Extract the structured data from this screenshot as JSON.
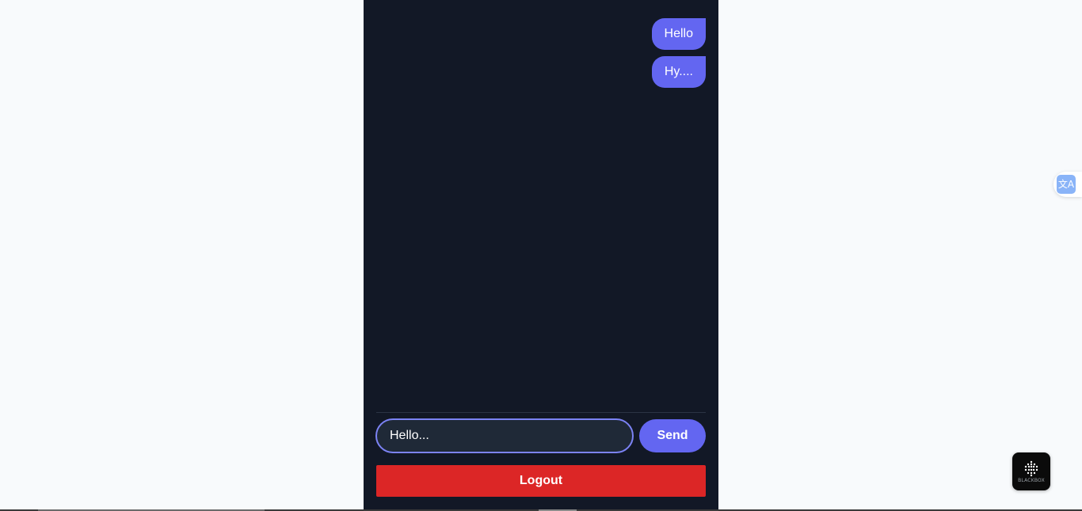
{
  "chat": {
    "messages": [
      {
        "text": "Hello",
        "sender": "self"
      },
      {
        "text": "Hy....",
        "sender": "self"
      }
    ],
    "input": {
      "value": "",
      "placeholder": "Hello..."
    },
    "send_label": "Send",
    "logout_label": "Logout"
  },
  "widgets": {
    "translate_icon": "translate-icon",
    "translate_glyph": "文A",
    "blackbox_label": "BLACKBOX"
  },
  "colors": {
    "page_background": "#f8fafc",
    "panel_background": "#121826",
    "accent": "#6366f1",
    "logout": "#dc2626",
    "input_background": "#1f2937",
    "input_border": "#7c83f5"
  }
}
